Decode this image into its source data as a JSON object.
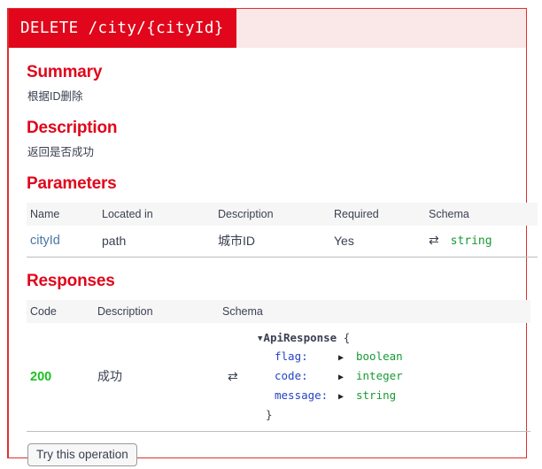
{
  "operation": {
    "method": "DELETE",
    "path": "/city/{cityId}",
    "header_bg": "#e1061b",
    "header_rest_bg": "#fae7e7",
    "border_color": "#e02f2f"
  },
  "summary": {
    "heading": "Summary",
    "text": "根据ID删除"
  },
  "description": {
    "heading": "Description",
    "text": "返回是否成功"
  },
  "parameters": {
    "heading": "Parameters",
    "columns": [
      "Name",
      "Located in",
      "Description",
      "Required",
      "Schema"
    ],
    "rows": [
      {
        "name": "cityId",
        "located_in": "path",
        "description": "城市ID",
        "required": "Yes",
        "schema_icon": "swap-icon",
        "schema_type": "string"
      }
    ]
  },
  "responses": {
    "heading": "Responses",
    "columns": [
      "Code",
      "Description",
      "Schema"
    ],
    "rows": [
      {
        "code": "200",
        "description": "成功",
        "schema_icon": "swap-icon",
        "model": {
          "toggle": "▼",
          "name": "ApiResponse",
          "open_brace": "{",
          "close_brace": "}",
          "properties": [
            {
              "key": "flag:",
              "toggle": "▶",
              "type": "boolean"
            },
            {
              "key": "code:",
              "toggle": "▶",
              "type": "integer"
            },
            {
              "key": "message:",
              "toggle": "▶",
              "type": "string"
            }
          ]
        }
      }
    ]
  },
  "actions": {
    "try_button": "Try this operation"
  },
  "colors": {
    "method_red": "#e1061b",
    "heading_red": "#e1061b",
    "link_blue": "#4a77a8",
    "type_green": "#179a34",
    "code_green": "#19c020",
    "prop_key_blue": "#2445c4"
  }
}
